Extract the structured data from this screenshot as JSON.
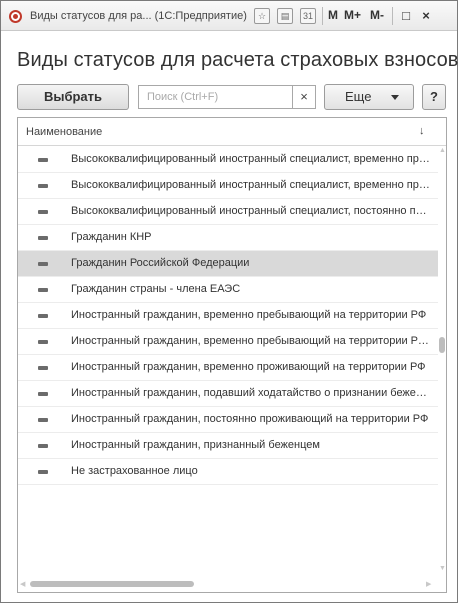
{
  "window": {
    "title": "Виды статусов для ра... (1С:Предприятие)",
    "memory_buttons": [
      "M",
      "M+",
      "M-"
    ],
    "controls": [
      "□",
      "×"
    ]
  },
  "page": {
    "title": "Виды статусов для расчета страховых взносов"
  },
  "toolbar": {
    "select_label": "Выбрать",
    "search_placeholder": "Поиск (Ctrl+F)",
    "clear_label": "×",
    "more_label": "Еще",
    "help_label": "?"
  },
  "table": {
    "column_header": "Наименование",
    "sort_indicator": "↓",
    "selected_index": 4,
    "rows": [
      "Высококвалифицированный иностранный специалист, временно пребывающий",
      "Высококвалифицированный иностранный специалист, временно проживающий",
      "Высококвалифицированный иностранный специалист, постоянно проживающий",
      "Гражданин КНР",
      "Гражданин Российской Федерации",
      "Гражданин страны - члена ЕАЭС",
      "Иностранный гражданин, временно пребывающий на территории РФ",
      "Иностранный гражданин, временно пребывающий на территории РФ (кроме ВКС)",
      "Иностранный гражданин, временно проживающий на территории РФ",
      "Иностранный гражданин, подавший ходатайство о признании беженцем",
      "Иностранный гражданин, постоянно проживающий на территории РФ",
      "Иностранный гражданин, признанный беженцем",
      "Не застрахованное лицо"
    ]
  }
}
